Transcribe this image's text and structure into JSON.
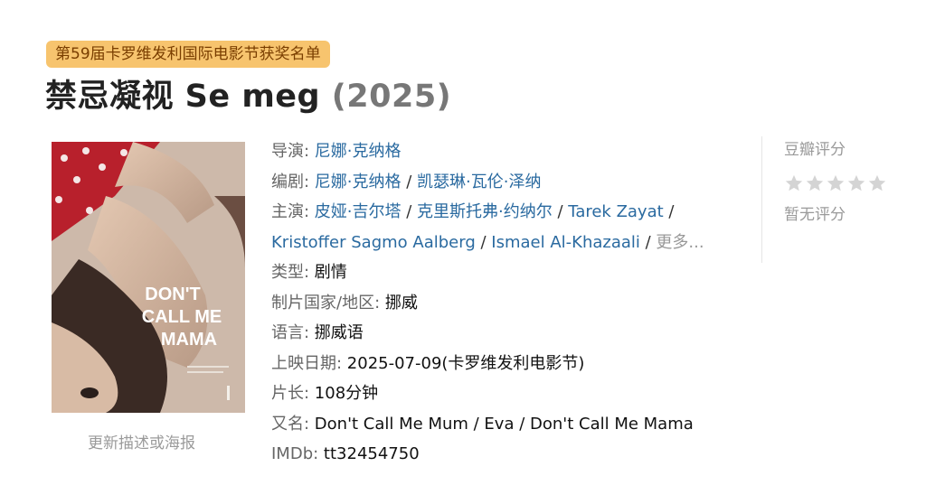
{
  "award_tag": "第59届卡罗维发利国际电影节获奖名单",
  "title": {
    "name": "禁忌凝视 Se meg",
    "year": "(2025)"
  },
  "poster": {
    "title_lines": [
      "DON'T",
      "CALL ME",
      "MAMA"
    ],
    "update_link": "更新描述或海报"
  },
  "info": {
    "director": {
      "label": "导演",
      "names": [
        "尼娜·克纳格"
      ]
    },
    "writer": {
      "label": "编剧",
      "names": [
        "尼娜·克纳格",
        "凯瑟琳·瓦伦·泽纳"
      ]
    },
    "cast": {
      "label": "主演",
      "line1": [
        "皮娅·吉尔塔",
        "克里斯托弗·约纳尔",
        "Tarek Zayat"
      ],
      "line2": [
        "Kristoffer Sagmo Aalberg",
        "Ismael Al-Khazaali"
      ],
      "more": "更多..."
    },
    "genre": {
      "label": "类型",
      "value": "剧情"
    },
    "country": {
      "label": "制片国家/地区",
      "value": "挪威"
    },
    "language": {
      "label": "语言",
      "value": "挪威语"
    },
    "release": {
      "label": "上映日期",
      "value": "2025-07-09(卡罗维发利电影节)"
    },
    "runtime": {
      "label": "片长",
      "value": "108分钟"
    },
    "aka": {
      "label": "又名",
      "value": "Don't Call Me Mum / Eva / Don't Call Me Mama"
    },
    "imdb": {
      "label": "IMDb",
      "value": "tt32454750"
    }
  },
  "rating": {
    "label": "豆瓣评分",
    "stars": 0,
    "no_rating": "暂无评分",
    "star_color": "#d4d4d4"
  },
  "colors": {
    "link": "#2a6aa0",
    "tag_bg": "#f7c46e",
    "tag_text": "#7a3e00"
  }
}
